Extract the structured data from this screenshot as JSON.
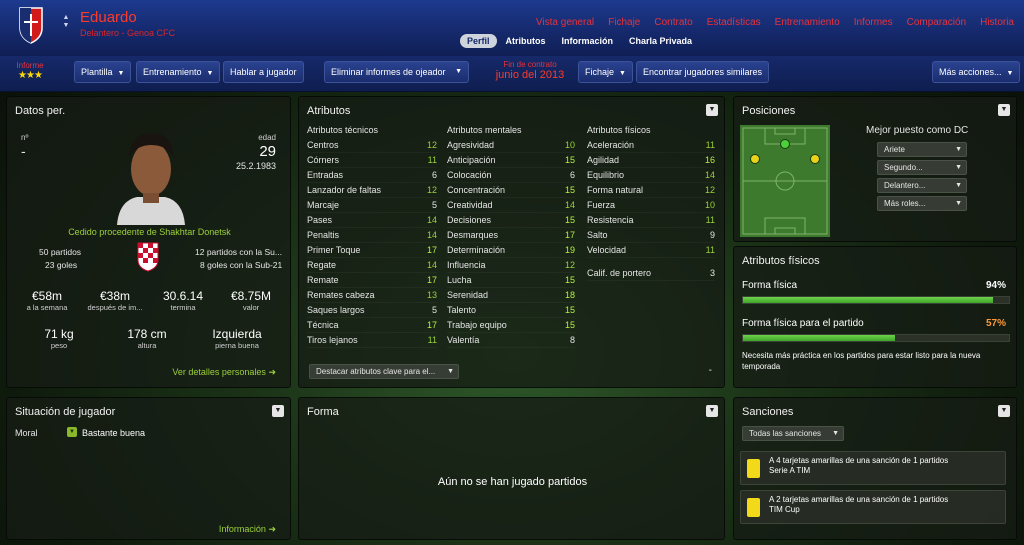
{
  "header": {
    "player_name": "Eduardo",
    "player_role": "Delantero - Genoa CFC",
    "nav_links": [
      "Vista general",
      "Fichaje",
      "Contrato",
      "Estadísticas",
      "Entrenamiento",
      "Informes",
      "Comparación",
      "Historia"
    ],
    "sub_tabs": [
      "Perfil",
      "Atributos",
      "Información",
      "Charla Privada"
    ],
    "active_sub_tab": "Perfil"
  },
  "toolbar": {
    "report_label": "Informe",
    "report_stars": "★★★",
    "squad_label": "Plantilla",
    "training_label": "Entrenamiento",
    "talk_label": "Hablar a jugador",
    "remove_scout_label": "Eliminar informes de ojeador",
    "contract_end_label": "Fin de contrato",
    "contract_end_value": "junio del 2013",
    "transfer_label": "Fichaje",
    "similar_label": "Encontrar jugadores similares",
    "more_label": "Más acciones..."
  },
  "personal": {
    "title": "Datos per.",
    "number_label": "nº",
    "number_value": "-",
    "age_label": "edad",
    "age_value": "29",
    "birthdate": "25.2.1983",
    "loan_text": "Cedido procedente de Shakhtar Donetsk",
    "matches": "50 partidos",
    "goals": "23 goles",
    "u21_matches": "12 partidos con la Su...",
    "u21_goals": "8 goles con la Sub-21",
    "stats": [
      {
        "value": "€58m",
        "label": "a la semana"
      },
      {
        "value": "€38m",
        "label": "después de im..."
      },
      {
        "value": "30.6.14",
        "label": "termina"
      },
      {
        "value": "€8.75M",
        "label": "valor"
      },
      {
        "value": "71 kg",
        "label": "peso"
      },
      {
        "value": "178 cm",
        "label": "altura"
      },
      {
        "value": "Izquierda",
        "label": "pierna buena"
      }
    ],
    "details_link": "Ver detalles personales"
  },
  "attributes": {
    "title": "Atributos",
    "technical_header": "Atributos técnicos",
    "mental_header": "Atributos mentales",
    "physical_header": "Atributos físicos",
    "technical": [
      {
        "name": "Centros",
        "value": "12"
      },
      {
        "name": "Córners",
        "value": "11"
      },
      {
        "name": "Entradas",
        "value": "6"
      },
      {
        "name": "Lanzador de faltas",
        "value": "12"
      },
      {
        "name": "Marcaje",
        "value": "5"
      },
      {
        "name": "Pases",
        "value": "14"
      },
      {
        "name": "Penaltis",
        "value": "14"
      },
      {
        "name": "Primer Toque",
        "value": "17"
      },
      {
        "name": "Regate",
        "value": "14"
      },
      {
        "name": "Remate",
        "value": "17"
      },
      {
        "name": "Remates cabeza",
        "value": "13"
      },
      {
        "name": "Saques largos",
        "value": "5"
      },
      {
        "name": "Técnica",
        "value": "17"
      },
      {
        "name": "Tiros lejanos",
        "value": "11"
      }
    ],
    "mental": [
      {
        "name": "Agresividad",
        "value": "10"
      },
      {
        "name": "Anticipación",
        "value": "15"
      },
      {
        "name": "Colocación",
        "value": "6"
      },
      {
        "name": "Concentración",
        "value": "15"
      },
      {
        "name": "Creatividad",
        "value": "14"
      },
      {
        "name": "Decisiones",
        "value": "15"
      },
      {
        "name": "Desmarques",
        "value": "17"
      },
      {
        "name": "Determinación",
        "value": "19"
      },
      {
        "name": "Influencia",
        "value": "12"
      },
      {
        "name": "Lucha",
        "value": "15"
      },
      {
        "name": "Serenidad",
        "value": "18"
      },
      {
        "name": "Talento",
        "value": "15"
      },
      {
        "name": "Trabajo equipo",
        "value": "15"
      },
      {
        "name": "Valentía",
        "value": "8"
      }
    ],
    "physical": [
      {
        "name": "Aceleración",
        "value": "11"
      },
      {
        "name": "Agilidad",
        "value": "16"
      },
      {
        "name": "Equilibrio",
        "value": "14"
      },
      {
        "name": "Forma natural",
        "value": "12"
      },
      {
        "name": "Fuerza",
        "value": "10"
      },
      {
        "name": "Resistencia",
        "value": "11"
      },
      {
        "name": "Salto",
        "value": "9"
      },
      {
        "name": "Velocidad",
        "value": "11"
      }
    ],
    "gk_name": "Calif. de portero",
    "gk_value": "3",
    "highlight_select": "Destacar atributos clave para el...",
    "dash": "-"
  },
  "positions": {
    "title": "Posiciones",
    "best_label": "Mejor puesto como DC",
    "options": [
      "Ariete",
      "Segundo...",
      "Delantero...",
      "Más roles..."
    ]
  },
  "physical_panel": {
    "title": "Atributos físicos",
    "fitness_label": "Forma física",
    "fitness_value": "94%",
    "fitness_fraction": 0.94,
    "match_label": "Forma física para el partido",
    "match_value": "57%",
    "match_fraction": 0.57,
    "note": "Necesita más práctica en los partidos para estar listo para la nueva temporada"
  },
  "situation": {
    "title": "Situación de jugador",
    "morale_label": "Moral",
    "morale_value": "Bastante buena",
    "info_link": "Información"
  },
  "form": {
    "title": "Forma",
    "empty_text": "Aún no se han jugado partidos"
  },
  "sanctions": {
    "title": "Sanciones",
    "filter": "Todas las sanciones",
    "items": [
      {
        "line1": "A 4 tarjetas amarillas de una sanción de 1 partidos",
        "line2": "Serie A TIM"
      },
      {
        "line1": "A 2 tarjetas amarillas de una sanción de 1 partidos",
        "line2": "TIM Cup"
      }
    ]
  }
}
